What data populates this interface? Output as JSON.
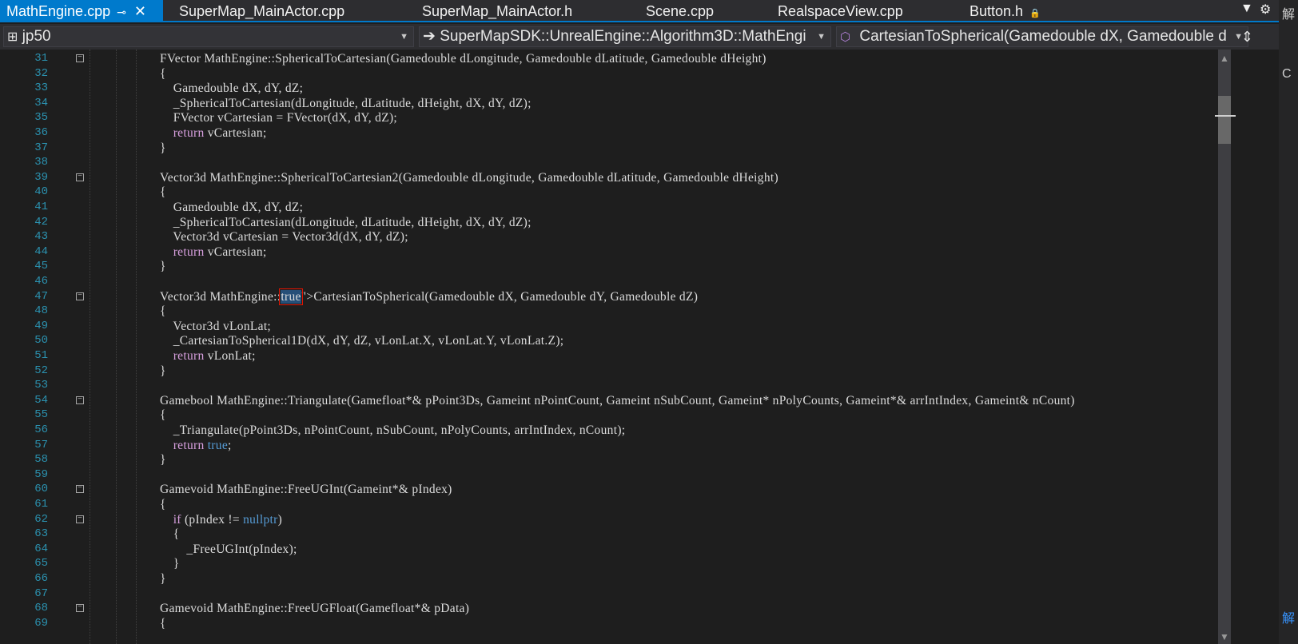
{
  "tabs": [
    {
      "label": "MathEngine.cpp",
      "active": true,
      "pin_icon": "⊸",
      "close_icon": "✕"
    },
    {
      "label": "SuperMap_MainActor.cpp"
    },
    {
      "label": "SuperMap_MainActor.h"
    },
    {
      "label": "Scene.cpp"
    },
    {
      "label": "RealspaceView.cpp"
    },
    {
      "label": "Button.h",
      "lock_icon": "🔒"
    }
  ],
  "navbar": {
    "project": "jp50",
    "scope": "SuperMapSDK::UnrealEngine::Algorithm3D::MathEngi",
    "member": "CartesianToSpherical(Gamedouble dX, Gamedouble d"
  },
  "right_panel": {
    "top_char": "解",
    "bottom_char": "解",
    "mid_char": "C"
  },
  "code_lines": [
    {
      "n": "31",
      "text": "FVector MathEngine::SphericalToCartesian(Gamedouble dLongitude, Gamedouble dLatitude, Gamedouble dHeight)",
      "fold": true
    },
    {
      "n": "32",
      "text": "{"
    },
    {
      "n": "33",
      "text": "    Gamedouble dX, dY, dZ;"
    },
    {
      "n": "34",
      "text": "    _SphericalToCartesian(dLongitude, dLatitude, dHeight, dX, dY, dZ);"
    },
    {
      "n": "35",
      "text": "    FVector vCartesian = FVector(dX, dY, dZ);"
    },
    {
      "n": "36",
      "text": "    return vCartesian;"
    },
    {
      "n": "37",
      "text": "}"
    },
    {
      "n": "38",
      "text": ""
    },
    {
      "n": "39",
      "text": "Vector3d MathEngine::SphericalToCartesian2(Gamedouble dLongitude, Gamedouble dLatitude, Gamedouble dHeight)",
      "fold": true
    },
    {
      "n": "40",
      "text": "{"
    },
    {
      "n": "41",
      "text": "    Gamedouble dX, dY, dZ;"
    },
    {
      "n": "42",
      "text": "    _SphericalToCartesian(dLongitude, dLatitude, dHeight, dX, dY, dZ);"
    },
    {
      "n": "43",
      "text": "    Vector3d vCartesian = Vector3d(dX, dY, dZ);"
    },
    {
      "n": "44",
      "text": "    return vCartesian;"
    },
    {
      "n": "45",
      "text": "}"
    },
    {
      "n": "46",
      "text": ""
    },
    {
      "n": "47",
      "text": "Vector3d MathEngine::CartesianToSpherical(Gamedouble dX, Gamedouble dY, Gamedouble dZ)",
      "fold": true,
      "highlight": "CartesianToSpherical"
    },
    {
      "n": "48",
      "text": "{"
    },
    {
      "n": "49",
      "text": "    Vector3d vLonLat;"
    },
    {
      "n": "50",
      "text": "    _CartesianToSpherical1D(dX, dY, dZ, vLonLat.X, vLonLat.Y, vLonLat.Z);"
    },
    {
      "n": "51",
      "text": "    return vLonLat;"
    },
    {
      "n": "52",
      "text": "}"
    },
    {
      "n": "53",
      "text": ""
    },
    {
      "n": "54",
      "text": "Gamebool MathEngine::Triangulate(Gamefloat*& pPoint3Ds, Gameint nPointCount, Gameint nSubCount, Gameint* nPolyCounts, Gameint*& arrIntIndex, Gameint& nCount)",
      "fold": true
    },
    {
      "n": "55",
      "text": "{"
    },
    {
      "n": "56",
      "text": "    _Triangulate(pPoint3Ds, nPointCount, nSubCount, nPolyCounts, arrIntIndex, nCount);"
    },
    {
      "n": "57",
      "text": "    return true;"
    },
    {
      "n": "58",
      "text": "}"
    },
    {
      "n": "59",
      "text": ""
    },
    {
      "n": "60",
      "text": "Gamevoid MathEngine::FreeUGInt(Gameint*& pIndex)",
      "fold": true
    },
    {
      "n": "61",
      "text": "{"
    },
    {
      "n": "62",
      "text": "    if (pIndex != nullptr)",
      "fold": true
    },
    {
      "n": "63",
      "text": "    {"
    },
    {
      "n": "64",
      "text": "        _FreeUGInt(pIndex);"
    },
    {
      "n": "65",
      "text": "    }"
    },
    {
      "n": "66",
      "text": "}"
    },
    {
      "n": "67",
      "text": ""
    },
    {
      "n": "68",
      "text": "Gamevoid MathEngine::FreeUGFloat(Gamefloat*& pData)",
      "fold": true
    },
    {
      "n": "69",
      "text": "{"
    }
  ]
}
